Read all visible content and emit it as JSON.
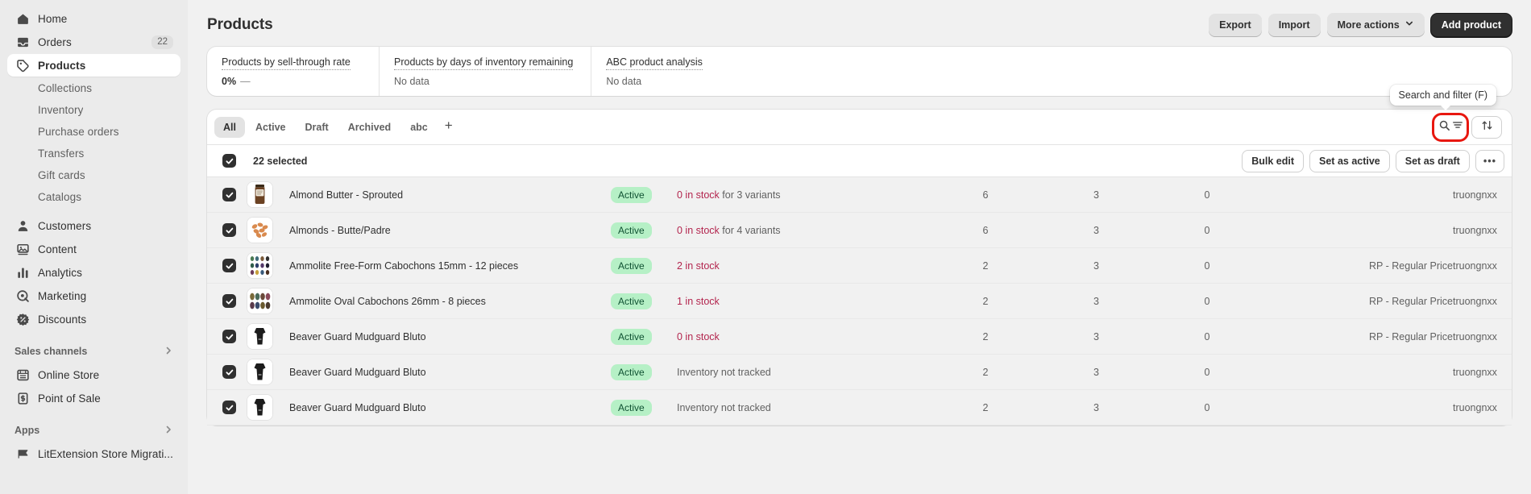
{
  "sidebar": {
    "items": [
      {
        "label": "Home",
        "icon": "home-icon",
        "type": "main",
        "key": "home"
      },
      {
        "label": "Orders",
        "icon": "orders-icon",
        "type": "main",
        "key": "orders",
        "badge": "22"
      },
      {
        "label": "Products",
        "icon": "products-tag-icon",
        "type": "main",
        "key": "products",
        "active": true
      },
      {
        "label": "Collections",
        "type": "sub",
        "key": "collections"
      },
      {
        "label": "Inventory",
        "type": "sub",
        "key": "inventory"
      },
      {
        "label": "Purchase orders",
        "type": "sub",
        "key": "purchase-orders"
      },
      {
        "label": "Transfers",
        "type": "sub",
        "key": "transfers"
      },
      {
        "label": "Gift cards",
        "type": "sub",
        "key": "gift-cards"
      },
      {
        "label": "Catalogs",
        "type": "sub",
        "key": "catalogs"
      },
      {
        "label": "Customers",
        "icon": "customers-person-icon",
        "type": "main",
        "key": "customers"
      },
      {
        "label": "Content",
        "icon": "content-image-icon",
        "type": "main",
        "key": "content"
      },
      {
        "label": "Analytics",
        "icon": "analytics-bars-icon",
        "type": "main",
        "key": "analytics"
      },
      {
        "label": "Marketing",
        "icon": "marketing-target-icon",
        "type": "main",
        "key": "marketing"
      },
      {
        "label": "Discounts",
        "icon": "discounts-percent-icon",
        "type": "main",
        "key": "discounts"
      }
    ],
    "sales_channels_label": "Sales channels",
    "sales_channels": [
      {
        "label": "Online Store",
        "icon": "store-icon",
        "key": "online-store"
      },
      {
        "label": "Point of Sale",
        "icon": "pos-icon",
        "key": "point-of-sale"
      }
    ],
    "apps_label": "Apps",
    "apps": [
      {
        "label": "LitExtension Store Migrati...",
        "icon": "flag-icon",
        "key": "litextension"
      }
    ]
  },
  "header": {
    "title": "Products",
    "export_label": "Export",
    "import_label": "Import",
    "more_actions_label": "More actions",
    "add_product_label": "Add product"
  },
  "metrics": [
    {
      "label": "Products by sell-through rate",
      "value": "0%",
      "suffix": "—",
      "no_data": false
    },
    {
      "label": "Products by days of inventory remaining",
      "value": "No data",
      "no_data": true
    },
    {
      "label": "ABC product analysis",
      "value": "No data",
      "no_data": true
    }
  ],
  "tabs": [
    {
      "label": "All",
      "selected": true
    },
    {
      "label": "Active",
      "selected": false
    },
    {
      "label": "Draft",
      "selected": false
    },
    {
      "label": "Archived",
      "selected": false
    },
    {
      "label": "abc",
      "selected": false
    }
  ],
  "tab_add_label": "+",
  "toolbar": {
    "search_filter_icon": "search-filter-icon",
    "sort_icon": "sort-arrows-icon",
    "tooltip": "Search and filter (F)"
  },
  "bulk_bar": {
    "selected_label": "22 selected",
    "bulk_edit_label": "Bulk edit",
    "set_active_label": "Set as active",
    "set_draft_label": "Set as draft",
    "more_label": "•••"
  },
  "rows": [
    {
      "name": "Almond Butter - Sprouted",
      "status": "Active",
      "stock_warn": "0 in stock",
      "stock_rest": " for 3 variants",
      "n1": "6",
      "n2": "3",
      "n3": "0",
      "price": "",
      "vendor": "truongnxx",
      "thumb": "jar-thumb",
      "checked": true
    },
    {
      "name": "Almonds - Butte/Padre",
      "status": "Active",
      "stock_warn": "0 in stock",
      "stock_rest": " for 4 variants",
      "n1": "6",
      "n2": "3",
      "n3": "0",
      "price": "",
      "vendor": "truongnxx",
      "thumb": "almonds-thumb",
      "checked": true
    },
    {
      "name": "Ammolite Free-Form Cabochons 15mm - 12 pieces",
      "status": "Active",
      "stock_warn": "2 in stock",
      "stock_rest": "",
      "n1": "2",
      "n2": "3",
      "n3": "0",
      "price": "RP - Regular Price",
      "vendor": "truongnxx",
      "thumb": "gems-grid-thumb",
      "checked": true
    },
    {
      "name": "Ammolite Oval Cabochons 26mm - 8 pieces",
      "status": "Active",
      "stock_warn": "1 in stock",
      "stock_rest": "",
      "n1": "2",
      "n2": "3",
      "n3": "0",
      "price": "RP - Regular Price",
      "vendor": "truongnxx",
      "thumb": "gems-oval-thumb",
      "checked": true
    },
    {
      "name": "Beaver Guard Mudguard Bluto",
      "status": "Active",
      "stock_warn": "0 in stock",
      "stock_rest": "",
      "n1": "2",
      "n2": "3",
      "n3": "0",
      "price": "RP - Regular Price",
      "vendor": "truongnxx",
      "thumb": "mudguard-thumb",
      "checked": true
    },
    {
      "name": "Beaver Guard Mudguard Bluto",
      "status": "Active",
      "stock_warn": "",
      "stock_rest": "Inventory not tracked",
      "n1": "2",
      "n2": "3",
      "n3": "0",
      "price": "",
      "vendor": "truongnxx",
      "thumb": "mudguard-thumb",
      "checked": true
    },
    {
      "name": "Beaver Guard Mudguard Bluto",
      "status": "Active",
      "stock_warn": "",
      "stock_rest": "Inventory not tracked",
      "n1": "2",
      "n2": "3",
      "n3": "0",
      "price": "",
      "vendor": "truongnxx",
      "thumb": "mudguard-thumb",
      "checked": true
    }
  ],
  "colors": {
    "accent_dark": "#303030",
    "highlight_red": "#e8170f",
    "badge_green_bg": "#b6f0c6",
    "stock_warn": "#b3254e"
  }
}
